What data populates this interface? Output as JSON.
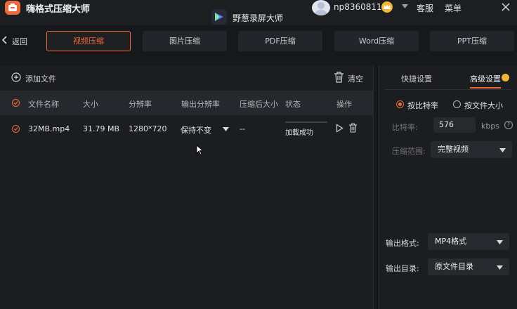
{
  "app": {
    "title": "嗨格式压缩大师"
  },
  "brand": {
    "name": "野葱录屏大师"
  },
  "user": {
    "name": "np8360811",
    "service": "客服",
    "menu": "菜单"
  },
  "nav": {
    "back_label": "返回",
    "tabs": [
      {
        "label": "视频压缩",
        "active": true
      },
      {
        "label": "图片压缩",
        "active": false
      },
      {
        "label": "PDF压缩",
        "active": false
      },
      {
        "label": "Word压缩",
        "active": false
      },
      {
        "label": "PPT压缩",
        "active": false
      }
    ]
  },
  "toolbar": {
    "add_file": "添加文件",
    "clear": "清空"
  },
  "table": {
    "headers": [
      "文件名称",
      "大小",
      "分辨率",
      "输出分辨率",
      "压缩后大小",
      "状态",
      "操作"
    ],
    "rows": [
      {
        "name": "32MB.mp4",
        "size": "31.79 MB",
        "resolution": "1280*720",
        "output_resolution": "保持不变",
        "compressed_size": "--",
        "status": "加载成功"
      }
    ]
  },
  "settings": {
    "tabs": [
      "快捷设置",
      "高级设置"
    ],
    "active_tab": "高级设置",
    "modes": [
      {
        "label": "按比特率",
        "selected": true
      },
      {
        "label": "按文件大小",
        "selected": false
      }
    ],
    "bitrate_label": "比特率:",
    "bitrate_value": "576",
    "bitrate_unit": "kbps",
    "help_glyph": "?",
    "range_label": "压缩范围:",
    "range_value": "完整视频",
    "format_label": "输出格式:",
    "format_value": "MP4格式",
    "dir_label": "输出目录:",
    "dir_value": "原文件目录"
  },
  "colors": {
    "accent": "#ef6a3a",
    "gold": "#f2b635",
    "background": "#17181c",
    "panel": "#1c1d21"
  }
}
